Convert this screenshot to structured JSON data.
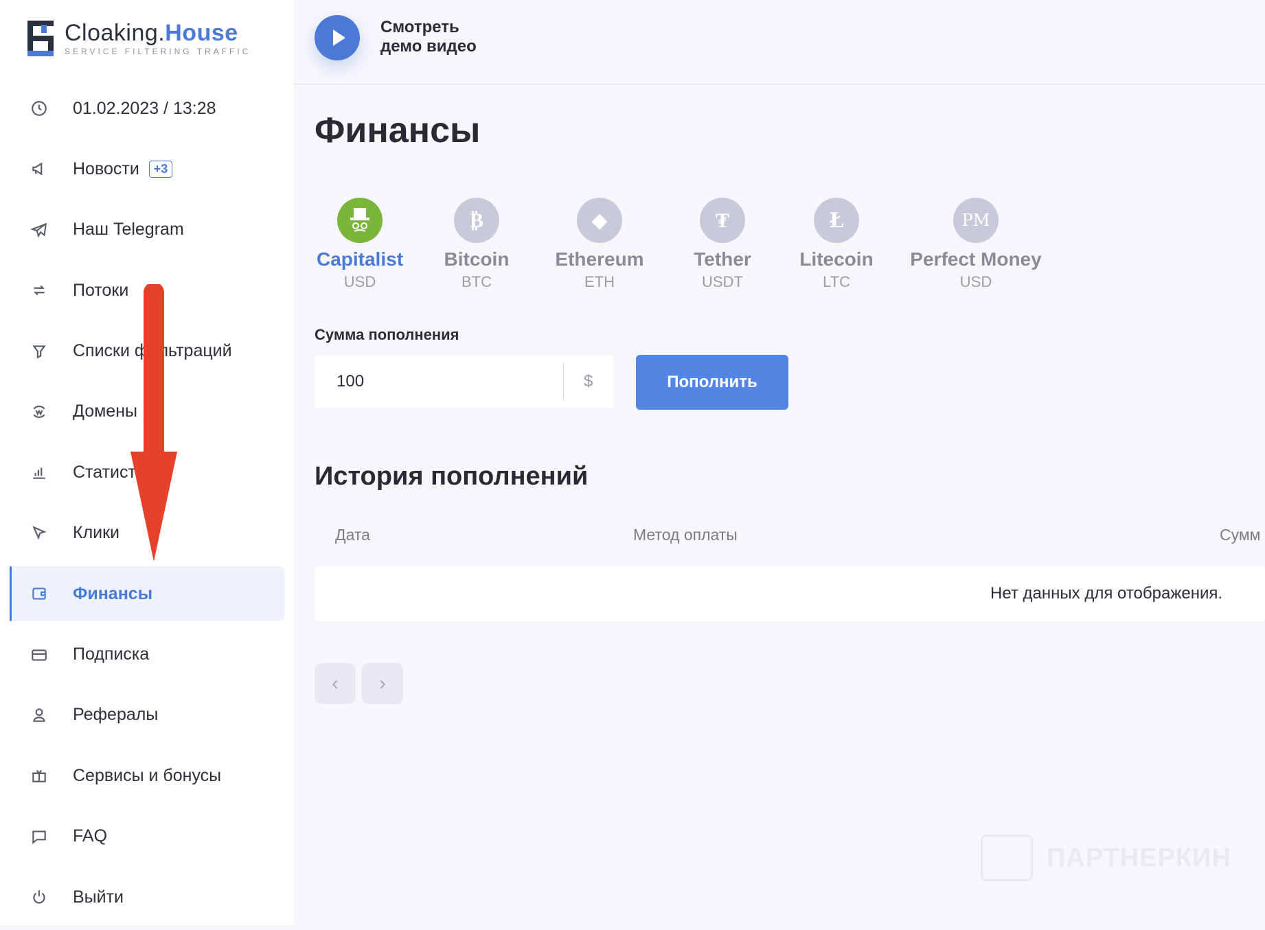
{
  "logo": {
    "part1": "Cloaking.",
    "part2": "House",
    "subtitle": "SERVICE FILTERING TRAFFIC"
  },
  "sidebar": {
    "items": [
      {
        "label": "01.02.2023 / 13:28",
        "icon": "clock-icon"
      },
      {
        "label": "Новости",
        "icon": "megaphone-icon",
        "badge": "+3"
      },
      {
        "label": "Наш Telegram",
        "icon": "telegram-icon"
      },
      {
        "label": "Потоки",
        "icon": "repeat-icon"
      },
      {
        "label": "Списки фильтраций",
        "icon": "filter-icon"
      },
      {
        "label": "Домены",
        "icon": "domain-icon"
      },
      {
        "label": "Статистика",
        "icon": "bar-chart-icon"
      },
      {
        "label": "Клики",
        "icon": "cursor-icon"
      },
      {
        "label": "Финансы",
        "icon": "wallet-icon",
        "active": true
      },
      {
        "label": "Подписка",
        "icon": "card-icon"
      },
      {
        "label": "Рефералы",
        "icon": "user-icon"
      },
      {
        "label": "Сервисы и бонусы",
        "icon": "gift-icon"
      },
      {
        "label": "FAQ",
        "icon": "chat-icon"
      },
      {
        "label": "Выйти",
        "icon": "power-icon"
      }
    ]
  },
  "topbar": {
    "demo_line1": "Смотреть",
    "demo_line2": "демо видео"
  },
  "page": {
    "title": "Финансы"
  },
  "payment_methods": [
    {
      "name": "Capitalist",
      "currency": "USD",
      "active": true,
      "color": "#7bb53a"
    },
    {
      "name": "Bitcoin",
      "currency": "BTC",
      "glyph": "₿"
    },
    {
      "name": "Ethereum",
      "currency": "ETH",
      "glyph": "◆"
    },
    {
      "name": "Tether",
      "currency": "USDT",
      "glyph": "₮"
    },
    {
      "name": "Litecoin",
      "currency": "LTC",
      "glyph": "Ł"
    },
    {
      "name": "Perfect Money",
      "currency": "USD",
      "glyph": "PM"
    }
  ],
  "topup": {
    "label": "Сумма пополнения",
    "value": "100",
    "currency": "$",
    "button": "Пополнить"
  },
  "history": {
    "title": "История пополнений",
    "columns": [
      "Дата",
      "Метод оплаты",
      "Сумм"
    ],
    "empty": "Нет данных для отображения."
  },
  "watermark": "ПАРТНЕРКИН",
  "colors": {
    "accent": "#4a7ad6",
    "annotation_arrow": "#e8412b"
  }
}
